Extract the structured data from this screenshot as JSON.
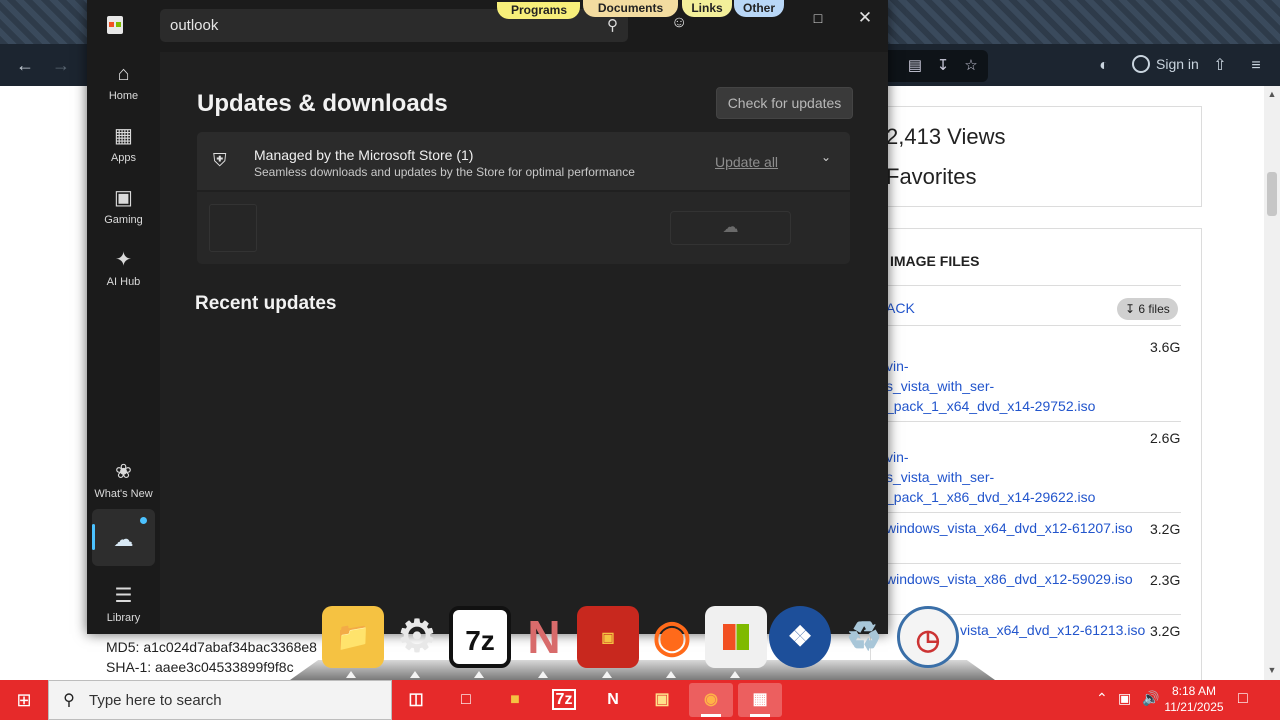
{
  "browser": {
    "signin_label": "Sign in"
  },
  "web_page": {
    "views_text": "2,413 Views",
    "favorites_text": "Favorites",
    "image_files_heading": "IMAGE FILES",
    "pack_link": "ACK",
    "files_badge": "6 files",
    "files": [
      {
        "lines": [
          "vin-",
          "s_vista_with_ser-",
          "_pack_1_x64_dvd_x14-29752.iso"
        ],
        "size": "3.6G"
      },
      {
        "lines": [
          "vin-",
          "s_vista_with_ser-",
          "_pack_1_x86_dvd_x14-29622.iso"
        ],
        "size": "2.6G"
      },
      {
        "lines": [
          "windows_vista_x64_dvd_x12-61207.iso"
        ],
        "size": "3.2G"
      },
      {
        "lines": [
          "windows_vista_x86_dvd_x12-59029.iso"
        ],
        "size": "2.3G"
      },
      {
        "lines": [
          "vista_x64_dvd_x12-61213.iso"
        ],
        "size": "3.2G"
      }
    ],
    "md5": "MD5: a1c024d7abaf34bac3368e8",
    "sha1": "SHA-1: aaee3c04533899f9f8c"
  },
  "toolbar_tabs": [
    {
      "label": "Programs",
      "color": "#f7ef7a"
    },
    {
      "label": "Documents",
      "color": "#f3dca0"
    },
    {
      "label": "Links",
      "color": "#f3ef9a"
    },
    {
      "label": "Other",
      "color": "#b9d7f7"
    }
  ],
  "store": {
    "search_value": "outlook",
    "sidebar": {
      "home": "Home",
      "apps": "Apps",
      "gaming": "Gaming",
      "ai_hub": "AI Hub",
      "whats_new": "What's New",
      "library": "Library"
    },
    "title": "Updates & downloads",
    "check_updates": "Check for updates",
    "managed_title": "Managed by the Microsoft Store (1)",
    "managed_sub": "Seamless downloads and updates by the Store for optimal performance",
    "update_all": "Update all",
    "recent_title": "Recent updates"
  },
  "dock": {
    "seven_zip_label": "7z"
  },
  "taskbar": {
    "search_placeholder": "Type here to search",
    "seven_zip_label": "7z",
    "time": "8:18 AM",
    "date": "11/21/2025",
    "color": "#e62a2a"
  }
}
